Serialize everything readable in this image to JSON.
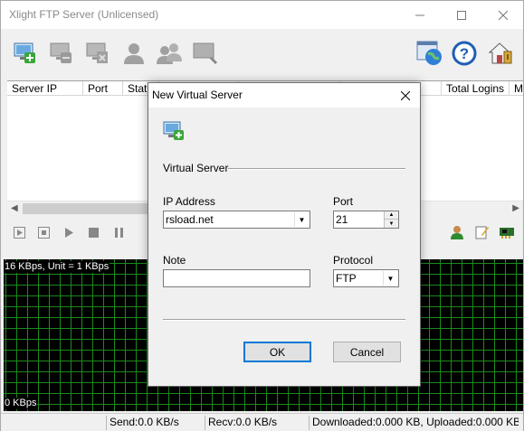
{
  "app": {
    "title": "Xlight FTP Server (Unlicensed)",
    "window_controls": {
      "minimize": "—",
      "maximize": "☐",
      "close": "✕"
    }
  },
  "toolbar": {
    "icons": [
      {
        "name": "add-server-icon"
      },
      {
        "name": "remove-server-icon"
      },
      {
        "name": "server-settings-icon"
      },
      {
        "name": "user-icon"
      },
      {
        "name": "users-group-icon"
      },
      {
        "name": "server-search-icon"
      },
      {
        "name": "global-options-icon"
      },
      {
        "name": "help-icon"
      },
      {
        "name": "home-security-icon"
      }
    ]
  },
  "server_list": {
    "columns": [
      "Server IP",
      "Port",
      "Status",
      "",
      "",
      "",
      "Total Logins",
      "M"
    ]
  },
  "graph": {
    "top_label": "16 KBps, Unit = 1 KBps",
    "bottom_label": "0 KBps"
  },
  "statusbar": {
    "send": "Send:0.0 KB/s",
    "recv": "Recv:0.0 KB/s",
    "transfer": "Downloaded:0.000 KB, Uploaded:0.000 KB"
  },
  "dialog": {
    "title": "New Virtual Server",
    "close_glyph": "✕",
    "section_label": "Virtual Server",
    "ip_label": "IP Address",
    "ip_value": "rsload.net",
    "port_label": "Port",
    "port_value": "21",
    "note_label": "Note",
    "note_value": "",
    "protocol_label": "Protocol",
    "protocol_value": "FTP",
    "ok_label": "OK",
    "cancel_label": "Cancel"
  },
  "colors": {
    "graph_background": "#000000",
    "graph_grid": "#1b8a1b",
    "accent_blue": "#0078d7",
    "help_blue": "#1f5fb5"
  }
}
